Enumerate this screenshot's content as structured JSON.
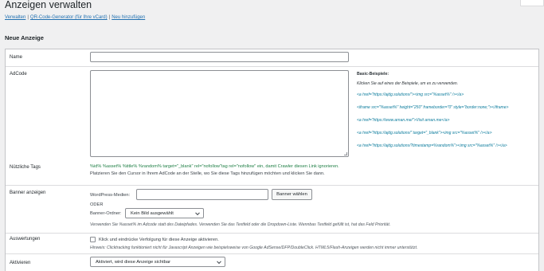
{
  "page_title": "Anzeigen verwalten",
  "subnav": {
    "links": [
      "Verwalten",
      "QR-Code-Generator (für Ihre vCard)",
      "Neu hinzufügen"
    ],
    "separator": "|"
  },
  "section_title": "Neue Anzeige",
  "form": {
    "name_label": "Name",
    "name_value": "",
    "adcode_label": "AdCode",
    "adcode_value": "",
    "examples": {
      "title": "Basic-Beispiele:",
      "intro": "Klicken Sie auf eines der Beispiele, um es zu verwenden.",
      "items": [
        "<a href=\"https://ajdg.solutions/\"><img src=\"%asset%\" /></a>",
        "<iframe src=\"%asset%\" height=\"250\" frameborder=\"0\" style=\"border:none;\"></iframe>",
        "<a href=\"https://www.arnan.me/\">Visit arnan.me</a>",
        "<a href=\"https://ajdg.solutions/\" target=\"_blank\"><img src=\"%asset%\" /></a>",
        "<a href=\"https://ajdg.solutions/?timestamp=%random%\"><img src=\"%asset%\" /></a>"
      ]
    },
    "tags_label": "Nützliche Tags",
    "tags_line": "%id% %asset% %title% %random% target=\"_blank\" rel=\"nofollow\"tag rel=\"nofollow\" ein, damit Crawler diesen Link ignorieren.",
    "tags_help": "Platzieren Sie den Cursor in Ihrem AdCode an der Stelle, wo Sie diese Tags hinzufügen möchten und klicken Sie dann.",
    "banner_label": "Banner anzeigen",
    "media_label": "WordPress-Medien:",
    "media_value": "",
    "choose_banner_button": "Banner wählen",
    "or_text": "ODER",
    "folder_label": "Banner-Ordner:",
    "folder_select": "Kein Bild ausgewählt",
    "banner_help": "Verwenden Sie %asset% im Adcode statt des Dateipfades. Verwenden Sie das Textfeld oder die Dropdown-Liste. Wennbas Textfeld gefüllt ist, hat das Feld Priorität.",
    "stats_label": "Auswertungen",
    "stats_checkbox_label": "Klick und eindrücke Verfolgung für diese Anzeige aktivieren.",
    "stats_checked": false,
    "stats_help": "Hinweis: Clicktracking funktioniert nicht für Javascript Anzeigen wie beispielsweise von Google AdSense/DFP/DoubleClick. HTML5/Flash-Anzeigen werden nicht immer unterstützt.",
    "activate_label": "Aktivieren",
    "activate_select": "Aktiviert, wird diese Anzeige sichtbar"
  }
}
